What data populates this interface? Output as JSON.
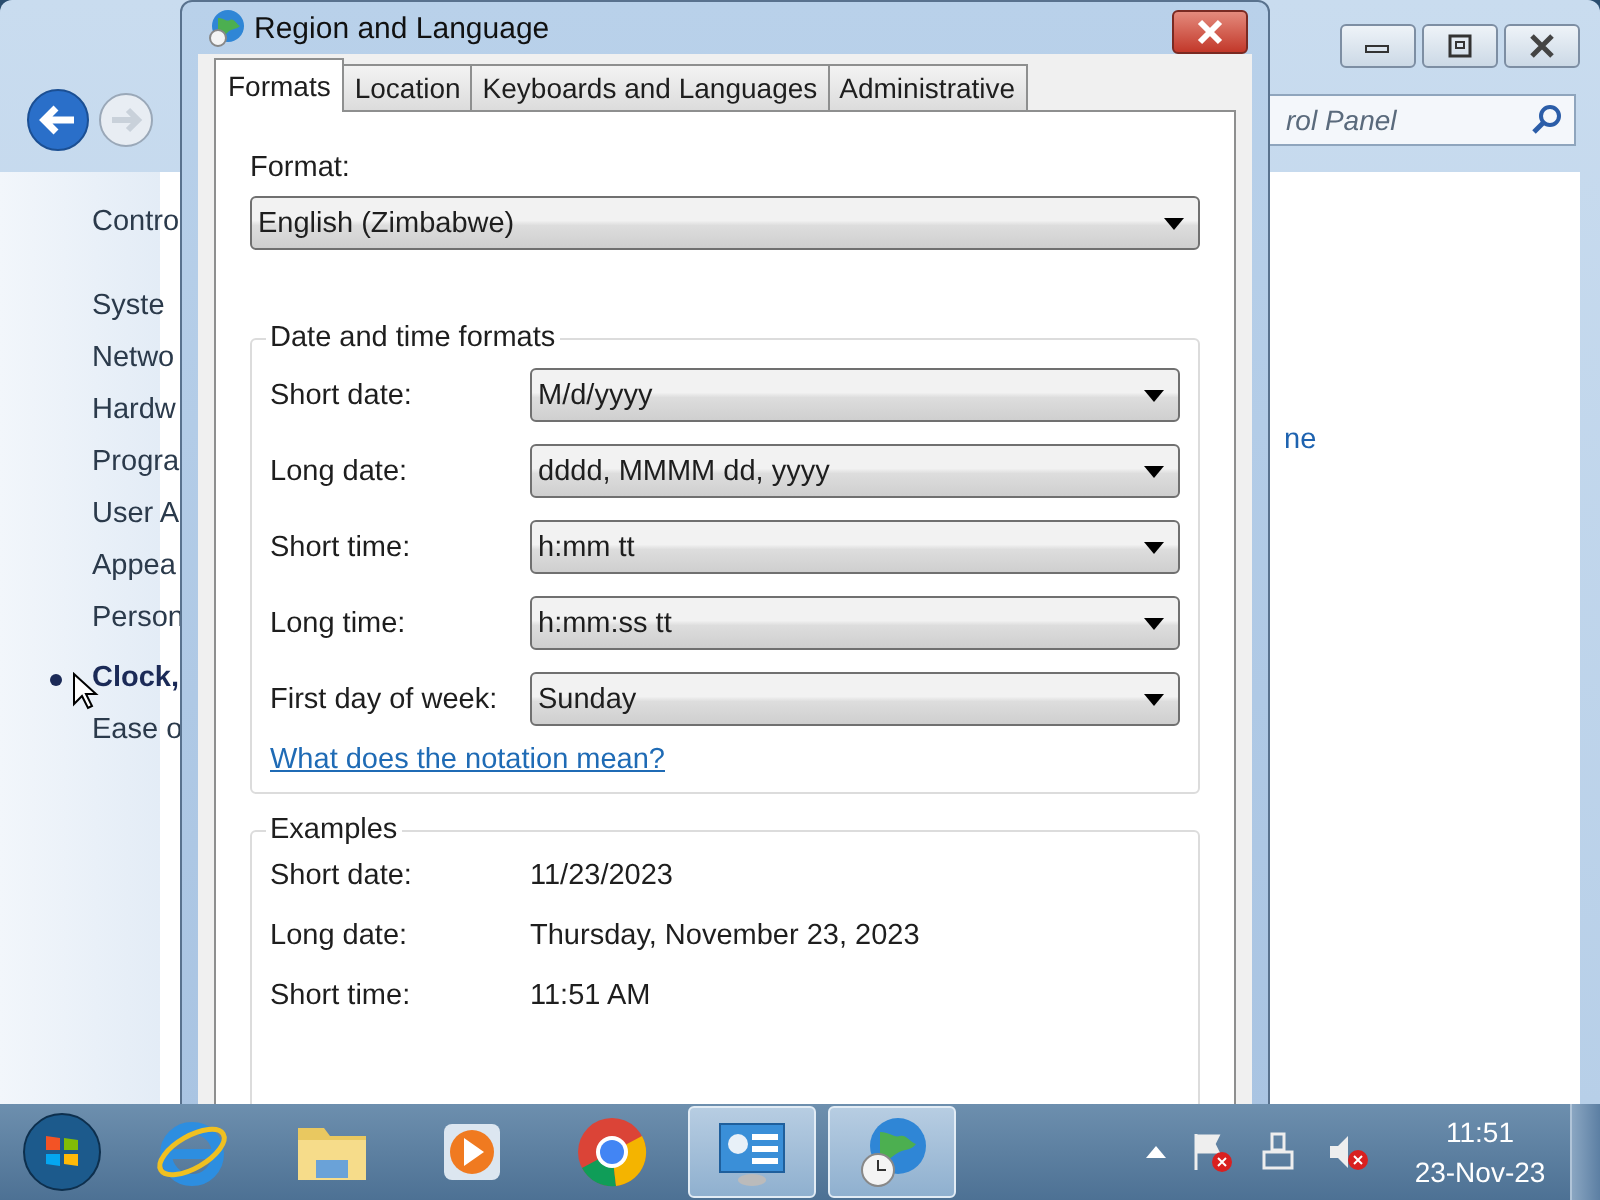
{
  "background_window": {
    "search": {
      "placeholder": "rol Panel"
    },
    "nav_items": [
      {
        "label": "Contro",
        "selected": false
      },
      {
        "label": "Syste",
        "selected": false
      },
      {
        "label": "Netwo",
        "selected": false
      },
      {
        "label": "Hardw",
        "selected": false
      },
      {
        "label": "Progra",
        "selected": false
      },
      {
        "label": "User A",
        "selected": false
      },
      {
        "label": "Appea",
        "selected": false
      },
      {
        "label": "Person",
        "selected": false
      },
      {
        "label": "Clock,",
        "selected": true
      },
      {
        "label": "Ease o",
        "selected": false
      }
    ],
    "link_fragment": "ne"
  },
  "dialog": {
    "title": "Region and Language",
    "tabs": [
      {
        "label": "Formats",
        "selected": true
      },
      {
        "label": "Location",
        "selected": false
      },
      {
        "label": "Keyboards and Languages",
        "selected": false
      },
      {
        "label": "Administrative",
        "selected": false
      }
    ],
    "format_label": "Format:",
    "format_value": "English (Zimbabwe)",
    "formats_group": {
      "title": "Date and time formats",
      "rows": [
        {
          "label": "Short date:",
          "value": "M/d/yyyy"
        },
        {
          "label": "Long date:",
          "value": "dddd, MMMM dd, yyyy"
        },
        {
          "label": "Short time:",
          "value": "h:mm tt"
        },
        {
          "label": "Long time:",
          "value": "h:mm:ss tt"
        },
        {
          "label": "First day of week:",
          "value": "Sunday"
        }
      ],
      "link": "What does the notation mean?"
    },
    "examples_group": {
      "title": "Examples",
      "rows": [
        {
          "label": "Short date:",
          "value": "11/23/2023"
        },
        {
          "label": "Long date:",
          "value": "Thursday, November 23, 2023"
        },
        {
          "label": "Short time:",
          "value": "11:51 AM"
        }
      ]
    }
  },
  "taskbar": {
    "apps": [
      {
        "kind": "browser-e",
        "selected": false
      },
      {
        "kind": "folder",
        "selected": false
      },
      {
        "kind": "player",
        "selected": false
      },
      {
        "kind": "chrome",
        "selected": false
      },
      {
        "kind": "panel",
        "selected": true
      },
      {
        "kind": "globe",
        "selected": true
      }
    ],
    "clock": {
      "time": "11:51",
      "date": "23-Nov-23"
    }
  }
}
